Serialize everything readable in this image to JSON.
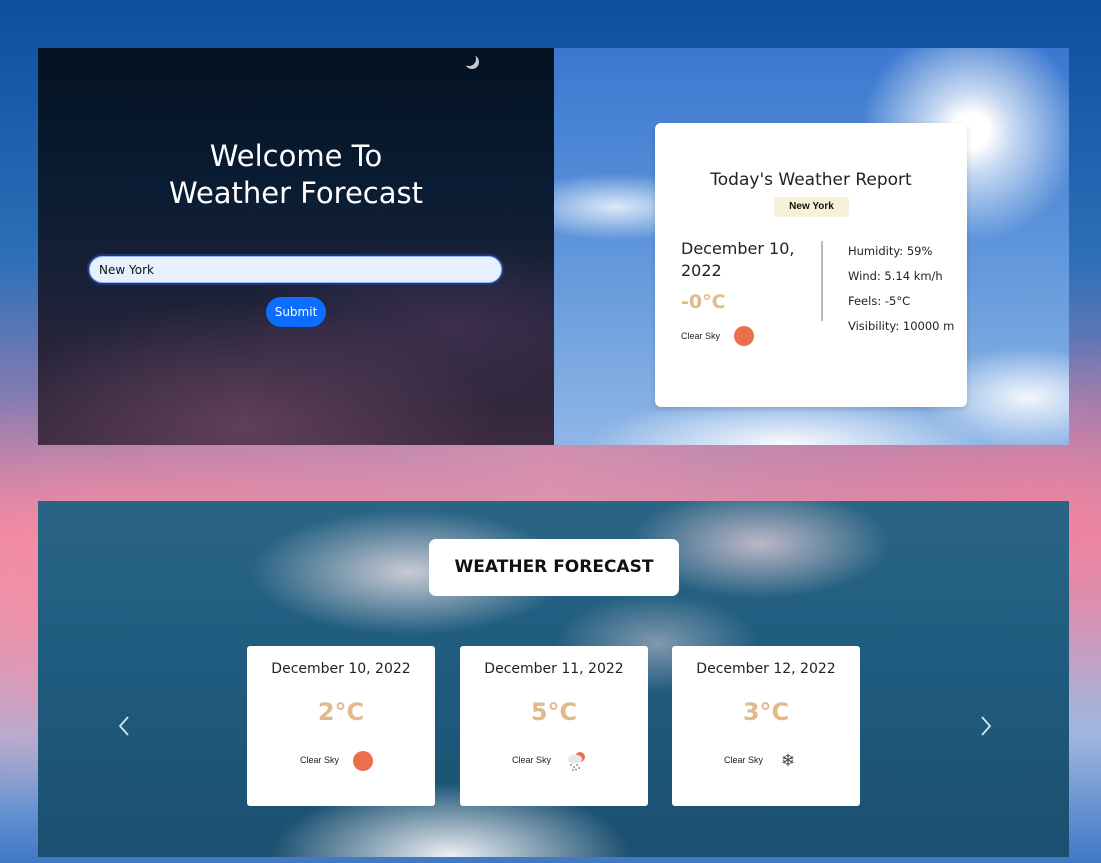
{
  "hero": {
    "welcome_line1": "Welcome To",
    "welcome_line2": "Weather Forecast",
    "search_value": "New York",
    "submit_label": "Submit"
  },
  "report": {
    "title": "Today's Weather Report",
    "city": "New York",
    "date_line1": "December 10,",
    "date_line2": "2022",
    "temperature": "-0°C",
    "condition": "Clear Sky",
    "condition_icon": "sun-icon",
    "humidity": "Humidity: 59%",
    "wind": "Wind: 5.14 km/h",
    "feels": "Feels: -5°C",
    "visibility": "Visibility: 10000 m"
  },
  "forecast": {
    "heading": "WEATHER FORECAST",
    "cards": [
      {
        "date": "December 10, 2022",
        "temperature": "2°C",
        "condition": "Clear Sky",
        "icon": "sun-icon"
      },
      {
        "date": "December 11, 2022",
        "temperature": "5°C",
        "condition": "Clear Sky",
        "icon": "snow-rain-icon"
      },
      {
        "date": "December 12, 2022",
        "temperature": "3°C",
        "condition": "Clear Sky",
        "icon": "snowflake-icon"
      }
    ]
  },
  "colors": {
    "accent_blue": "#0d6efd",
    "temperature": "#e2b98a",
    "sun": "#ec6e4c",
    "badge_bg": "#f5f2d6"
  }
}
